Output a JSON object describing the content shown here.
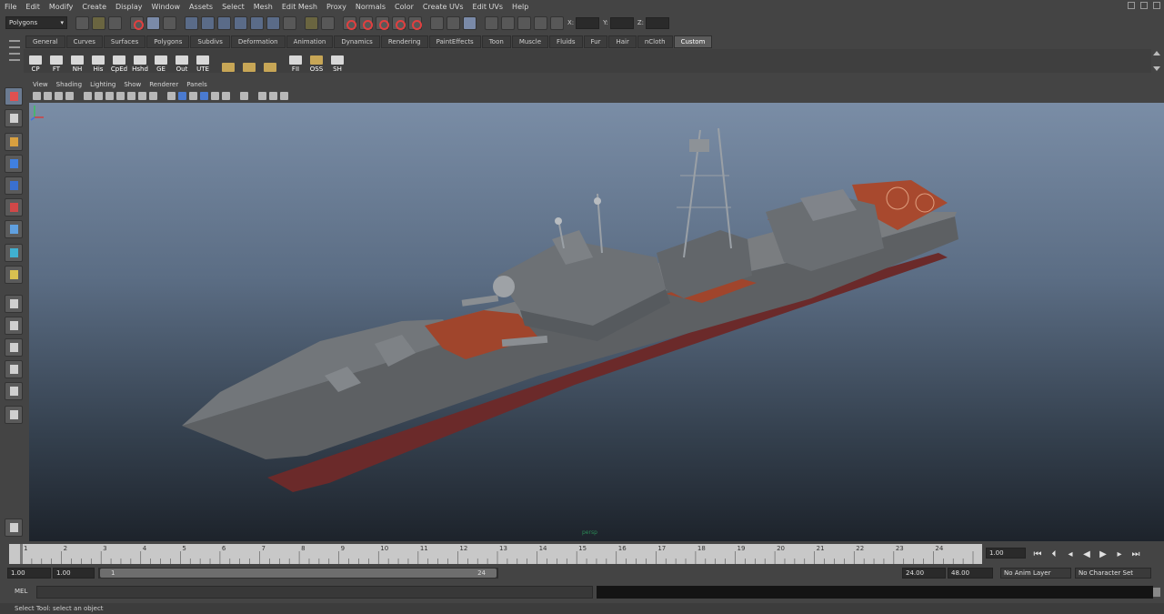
{
  "menus": [
    "File",
    "Edit",
    "Modify",
    "Create",
    "Display",
    "Window",
    "Assets",
    "Select",
    "Mesh",
    "Edit Mesh",
    "Proxy",
    "Normals",
    "Color",
    "Create UVs",
    "Edit UVs",
    "Help"
  ],
  "status": {
    "mode": "Polygons",
    "x_label": "X:",
    "y_label": "Y:",
    "z_label": "Z:"
  },
  "shelf_tabs": [
    "General",
    "Curves",
    "Surfaces",
    "Polygons",
    "Subdivs",
    "Deformation",
    "Animation",
    "Dynamics",
    "Rendering",
    "PaintEffects",
    "Toon",
    "Muscle",
    "Fluids",
    "Fur",
    "Hair",
    "nCloth",
    "Custom"
  ],
  "shelf_active_tab": "Custom",
  "shelf_buttons": [
    "CP",
    "FT",
    "NH",
    "His",
    "CpEd",
    "Hshd",
    "GE",
    "Out",
    "UTE",
    "",
    "",
    "",
    "FII",
    "OSS",
    "SH"
  ],
  "panel_menu": [
    "View",
    "Shading",
    "Lighting",
    "Show",
    "Renderer",
    "Panels"
  ],
  "viewport": {
    "camera": "persp"
  },
  "timeline": {
    "ticks": [
      "1",
      "2",
      "3",
      "4",
      "5",
      "6",
      "7",
      "8",
      "9",
      "10",
      "11",
      "12",
      "13",
      "14",
      "15",
      "16",
      "17",
      "18",
      "19",
      "20",
      "21",
      "22",
      "23",
      "24"
    ],
    "current_frame": "1.00"
  },
  "range": {
    "start": "1.00",
    "anim_start": "1.00",
    "slider_start": "1",
    "slider_end": "24",
    "end": "24.00",
    "anim_end": "48.00",
    "anim_layer": "No Anim Layer",
    "character_set": "No Character Set"
  },
  "command": {
    "mel_label": "MEL"
  },
  "help_line": "Select Tool: select an object",
  "colors": {
    "deck": "#a0452c",
    "hull": "#5d6063",
    "hull_bottom": "#6b2a2a"
  }
}
